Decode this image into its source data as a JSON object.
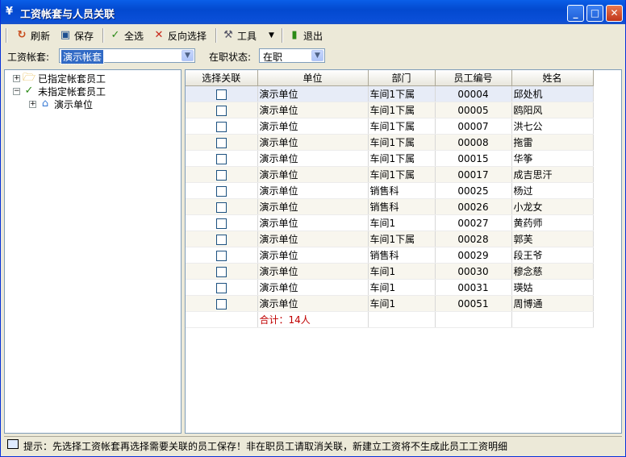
{
  "window": {
    "title": "工资帐套与人员关联",
    "title_icon": "¥"
  },
  "toolbar": {
    "refresh": "刷新",
    "save": "保存",
    "select_all": "全选",
    "invert": "反向选择",
    "tools": "工具",
    "exit": "退出"
  },
  "filter": {
    "account_label": "工资帐套:",
    "account_value": "演示帐套",
    "status_label": "在职状态:",
    "status_value": "在职"
  },
  "tree": {
    "assigned": "已指定帐套员工",
    "unassigned": "未指定帐套员工",
    "unit": "演示单位"
  },
  "grid": {
    "columns": [
      "选择关联",
      "单位",
      "部门",
      "员工编号",
      "姓名"
    ],
    "rows": [
      {
        "unit": "演示单位",
        "dept": "车间1下属",
        "id": "00004",
        "name": "邱处机"
      },
      {
        "unit": "演示单位",
        "dept": "车间1下属",
        "id": "00005",
        "name": "鸥阳风"
      },
      {
        "unit": "演示单位",
        "dept": "车间1下属",
        "id": "00007",
        "name": "洪七公"
      },
      {
        "unit": "演示单位",
        "dept": "车间1下属",
        "id": "00008",
        "name": "拖雷"
      },
      {
        "unit": "演示单位",
        "dept": "车间1下属",
        "id": "00015",
        "name": "华筝"
      },
      {
        "unit": "演示单位",
        "dept": "车间1下属",
        "id": "00017",
        "name": "成吉思汗"
      },
      {
        "unit": "演示单位",
        "dept": "销售科",
        "id": "00025",
        "name": "杨过"
      },
      {
        "unit": "演示单位",
        "dept": "销售科",
        "id": "00026",
        "name": "小龙女"
      },
      {
        "unit": "演示单位",
        "dept": "车间1",
        "id": "00027",
        "name": "黄药师"
      },
      {
        "unit": "演示单位",
        "dept": "车间1下属",
        "id": "00028",
        "name": "郭芙"
      },
      {
        "unit": "演示单位",
        "dept": "销售科",
        "id": "00029",
        "name": "段王爷"
      },
      {
        "unit": "演示单位",
        "dept": "车间1",
        "id": "00030",
        "name": "穆念慈"
      },
      {
        "unit": "演示单位",
        "dept": "车间1",
        "id": "00031",
        "name": "瑛姑"
      },
      {
        "unit": "演示单位",
        "dept": "车间1",
        "id": "00051",
        "name": "周博通"
      }
    ],
    "total": "合计：14人"
  },
  "status": {
    "text": "提示：先选择工资帐套再选择需要关联的员工保存！非在职员工请取消关联，新建立工资将不生成此员工工资明细"
  }
}
